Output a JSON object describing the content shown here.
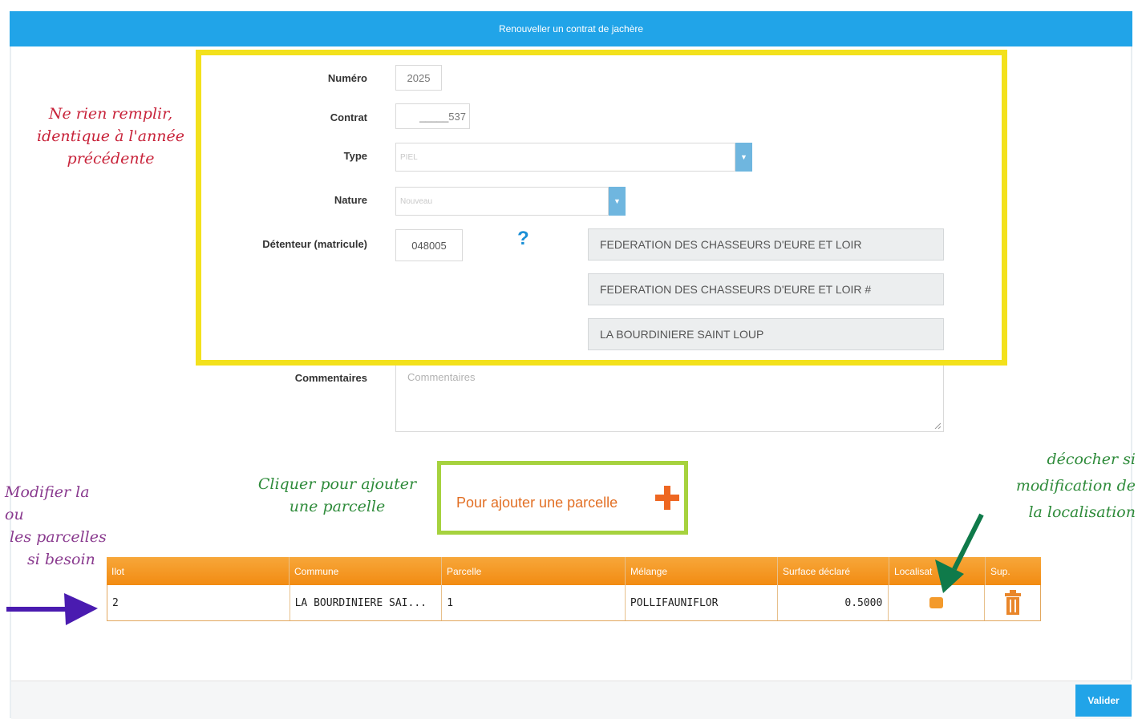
{
  "header": {
    "title": "Renouveller un contrat de jachère"
  },
  "form": {
    "numero_label": "Numéro",
    "numero_value": "2025",
    "contrat_label": "Contrat",
    "contrat_value": "_____537",
    "type_label": "Type",
    "type_value": "PIEL",
    "nature_label": "Nature",
    "nature_value": "Nouveau",
    "detenteur_label": "Détenteur (matricule)",
    "detenteur_value": "048005",
    "help_symbol": "?",
    "detenteur_line1": "FEDERATION DES CHASSEURS D'EURE ET LOIR",
    "detenteur_line2": "FEDERATION DES CHASSEURS D'EURE ET LOIR #",
    "detenteur_line3": "LA BOURDINIERE SAINT LOUP",
    "commentaires_label": "Commentaires",
    "commentaires_placeholder": "Commentaires"
  },
  "add_parcel": {
    "label": "Pour ajouter une parcelle",
    "icon": "plus-icon"
  },
  "table": {
    "columns": [
      "Ilot",
      "Commune",
      "Parcelle",
      "Mélange",
      "Surface déclaré",
      "Localisat",
      "Sup."
    ],
    "rows": [
      {
        "ilot": "2",
        "commune": "LA BOURDINIERE SAI...",
        "parcelle": "1",
        "melange": "POLLIFAUNIFLOR",
        "surface": "0.5000"
      }
    ]
  },
  "annotations": {
    "red": [
      "Ne rien remplir,",
      "identique à l'année",
      "précédente"
    ],
    "purple": [
      "Modifier la ou",
      "les parcelles",
      "si besoin"
    ],
    "green_add": [
      "Cliquer pour ajouter",
      "une parcelle"
    ],
    "green_loc": [
      "décocher si",
      "modification de",
      "la localisation"
    ]
  },
  "footer": {
    "validate_label": "Valider"
  },
  "colors": {
    "header": "#21a4e8",
    "table_header": "#f59a22",
    "yellow": "#f3e11c",
    "green": "#a6d23e",
    "red_note": "#c8233a",
    "purple_note": "#8a3b8f",
    "green_note": "#2e8b3a",
    "arrow_purple": "#4a1bb0",
    "arrow_green": "#0f7a4a"
  }
}
